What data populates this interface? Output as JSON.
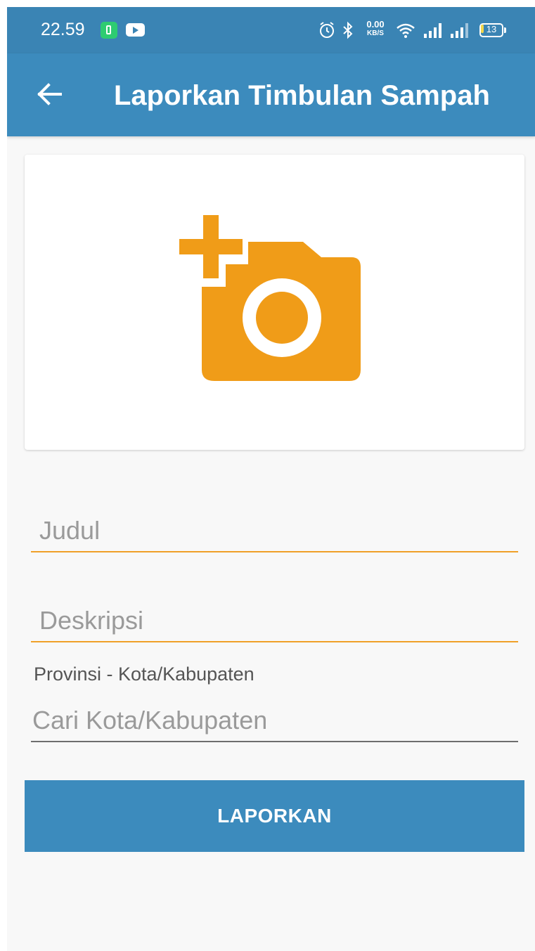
{
  "status_bar": {
    "time": "22.59",
    "network_speed_value": "0.00",
    "network_speed_unit": "KB/S",
    "battery_level": "13",
    "icons": [
      "battery-charging-icon",
      "youtube-icon",
      "alarm-icon",
      "bluetooth-icon",
      "wifi-icon",
      "signal-icon",
      "signal-icon",
      "battery-icon"
    ]
  },
  "app_bar": {
    "title": "Laporkan Timbulan Sampah",
    "back_icon": "arrow-left-icon"
  },
  "photo_picker": {
    "icon": "add-photo-camera-icon",
    "icon_color": "#f09c18"
  },
  "form": {
    "judul": {
      "placeholder": "Judul",
      "value": ""
    },
    "deskripsi": {
      "placeholder": "Deskripsi",
      "value": ""
    },
    "location_label": "Provinsi - Kota/Kabupaten",
    "kota": {
      "placeholder": "Cari Kota/Kabupaten",
      "value": ""
    },
    "submit_label": "LAPORKAN"
  },
  "colors": {
    "primary": "#3c8bbd",
    "status_bar": "#3a84b4",
    "accent": "#f0a028",
    "background": "#f8f8f8"
  }
}
